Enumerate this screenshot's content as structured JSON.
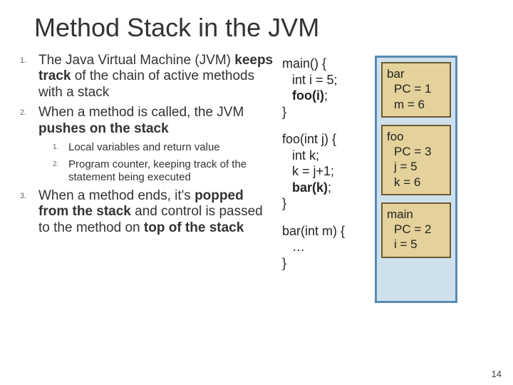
{
  "title": "Method Stack in the JVM",
  "points": {
    "p1_num": "1.",
    "p1_pre": "The Java Virtual Machine (JVM) ",
    "p1_bold": "keeps track",
    "p1_post": " of the chain of active methods with a stack",
    "p2_num": "2.",
    "p2_pre": "When a method is called, the JVM ",
    "p2_bold": "pushes on the stack",
    "sub1_num": "1.",
    "sub1": "Local variables and return value",
    "sub2_num": "2.",
    "sub2": "Program counter, keeping track of the statement being executed",
    "p3_num": "3.",
    "p3_a": "When a method ends, it's ",
    "p3_b": "popped from the stack",
    "p3_c": " and control is passed to the method on ",
    "p3_d": "top of the stack"
  },
  "code": {
    "main_sig": "main() {",
    "main_l1": "int i = 5;",
    "main_l2": "foo(i)",
    "main_l3": ";",
    "main_close": "}",
    "foo_sig": "foo(int j) {",
    "foo_l1": "int k;",
    "foo_l2": "k = j+1;",
    "foo_l3a": "bar(k)",
    "foo_l3b": ";",
    "foo_close": "}",
    "bar_sig": "bar(int m) {",
    "bar_l1": "…",
    "bar_close": "}"
  },
  "stack": {
    "f0_name": "bar",
    "f0_l1": "PC = 1",
    "f0_l2": "m = 6",
    "f1_name": "foo",
    "f1_l1": "PC = 3",
    "f1_l2": "j = 5",
    "f1_l3": "k = 6",
    "f2_name": "main",
    "f2_l1": "PC = 2",
    "f2_l2": "i = 5"
  },
  "page_num": "14"
}
